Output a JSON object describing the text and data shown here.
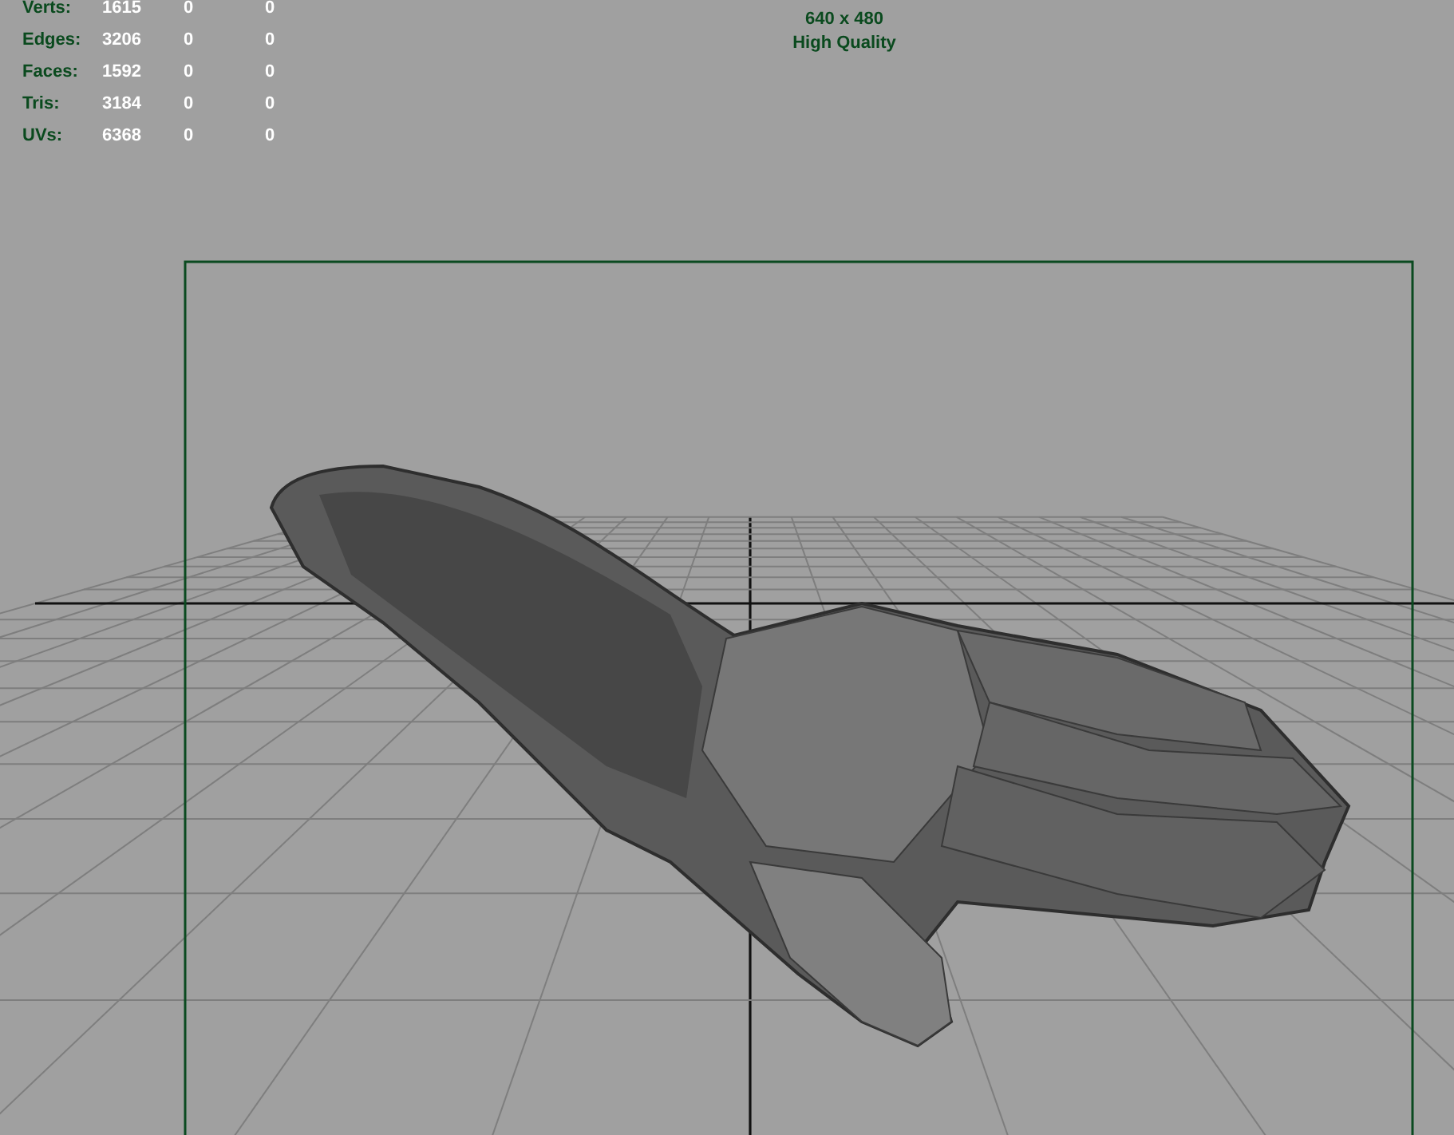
{
  "poly_count": [
    {
      "label": "Verts:",
      "values": [
        "1615",
        "0",
        "0"
      ]
    },
    {
      "label": "Edges:",
      "values": [
        "3206",
        "0",
        "0"
      ]
    },
    {
      "label": "Faces:",
      "values": [
        "1592",
        "0",
        "0"
      ]
    },
    {
      "label": "Tris:",
      "values": [
        "3184",
        "0",
        "0"
      ]
    },
    {
      "label": "UVs:",
      "values": [
        "6368",
        "0",
        "0"
      ]
    }
  ],
  "resolution_gate": {
    "size": "640 x 480",
    "quality": "High Quality"
  }
}
